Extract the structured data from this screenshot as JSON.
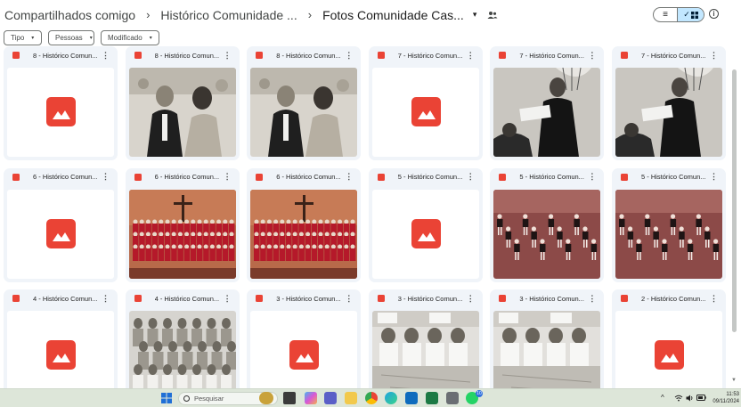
{
  "breadcrumb": {
    "root": "Compartilhados comigo",
    "middle": "Histórico Comunidade ...",
    "current": "Fotos Comunidade Cas...",
    "separator": "›",
    "caret": "▾",
    "shared_icon": "people-icon"
  },
  "view_toggle": {
    "list_icon": "list-icon",
    "grid_icon": "grid-icon",
    "selected": "grid",
    "list_glyph": "≡",
    "check_glyph": "✓"
  },
  "info_icon": {
    "icon": "info-icon",
    "glyph": "i"
  },
  "filters": [
    {
      "label": "Tipo",
      "caret": "▾"
    },
    {
      "label": "Pessoas",
      "caret": "▾"
    },
    {
      "label": "Modificado",
      "caret": "▾"
    }
  ],
  "menu_glyph": "⋮",
  "files": [
    {
      "title": "8 - Histórico Comun...",
      "thumb": "placeholder"
    },
    {
      "title": "8 - Histórico Comun...",
      "thumb": "couple"
    },
    {
      "title": "8 - Histórico Comun...",
      "thumb": "couple"
    },
    {
      "title": "7 - Histórico Comun...",
      "thumb": "placeholder"
    },
    {
      "title": "7 - Histórico Comun...",
      "thumb": "pastor"
    },
    {
      "title": "7 - Histórico Comun...",
      "thumb": "pastor"
    },
    {
      "title": "6 - Histórico Comun...",
      "thumb": "placeholder"
    },
    {
      "title": "6 - Histórico Comun...",
      "thumb": "choir"
    },
    {
      "title": "6 - Histórico Comun...",
      "thumb": "choir"
    },
    {
      "title": "5 - Histórico Comun...",
      "thumb": "placeholder"
    },
    {
      "title": "5 - Histórico Comun...",
      "thumb": "dance"
    },
    {
      "title": "5 - Histórico Comun...",
      "thumb": "dance"
    },
    {
      "title": "4 - Histórico Comun...",
      "thumb": "placeholder"
    },
    {
      "title": "4 - Histórico Comun...",
      "thumb": "group"
    },
    {
      "title": "3 - Histórico Comun...",
      "thumb": "placeholder"
    },
    {
      "title": "3 - Histórico Comun...",
      "thumb": "table"
    },
    {
      "title": "3 - Histórico Comun...",
      "thumb": "table"
    },
    {
      "title": "2 - Histórico Comun...",
      "thumb": "placeholder"
    }
  ],
  "taskbar": {
    "search_placeholder": "Pesquisar",
    "badge": "10",
    "tray_caret": "^",
    "clock_time": "11:53",
    "clock_date": "09/11/2024",
    "apps": [
      "windows-icon",
      "widgets-icon",
      "copilot-icon",
      "teams-icon",
      "explorer-icon",
      "chrome-icon",
      "edge-icon",
      "outlook-icon",
      "excel-icon",
      "calculator-icon",
      "whatsapp-icon"
    ]
  },
  "colors": {
    "accent": "#c2e7ff",
    "card_bg": "#f0f4f9",
    "placeholder_red": "#ea4335",
    "taskbar": "#dde6d9"
  }
}
